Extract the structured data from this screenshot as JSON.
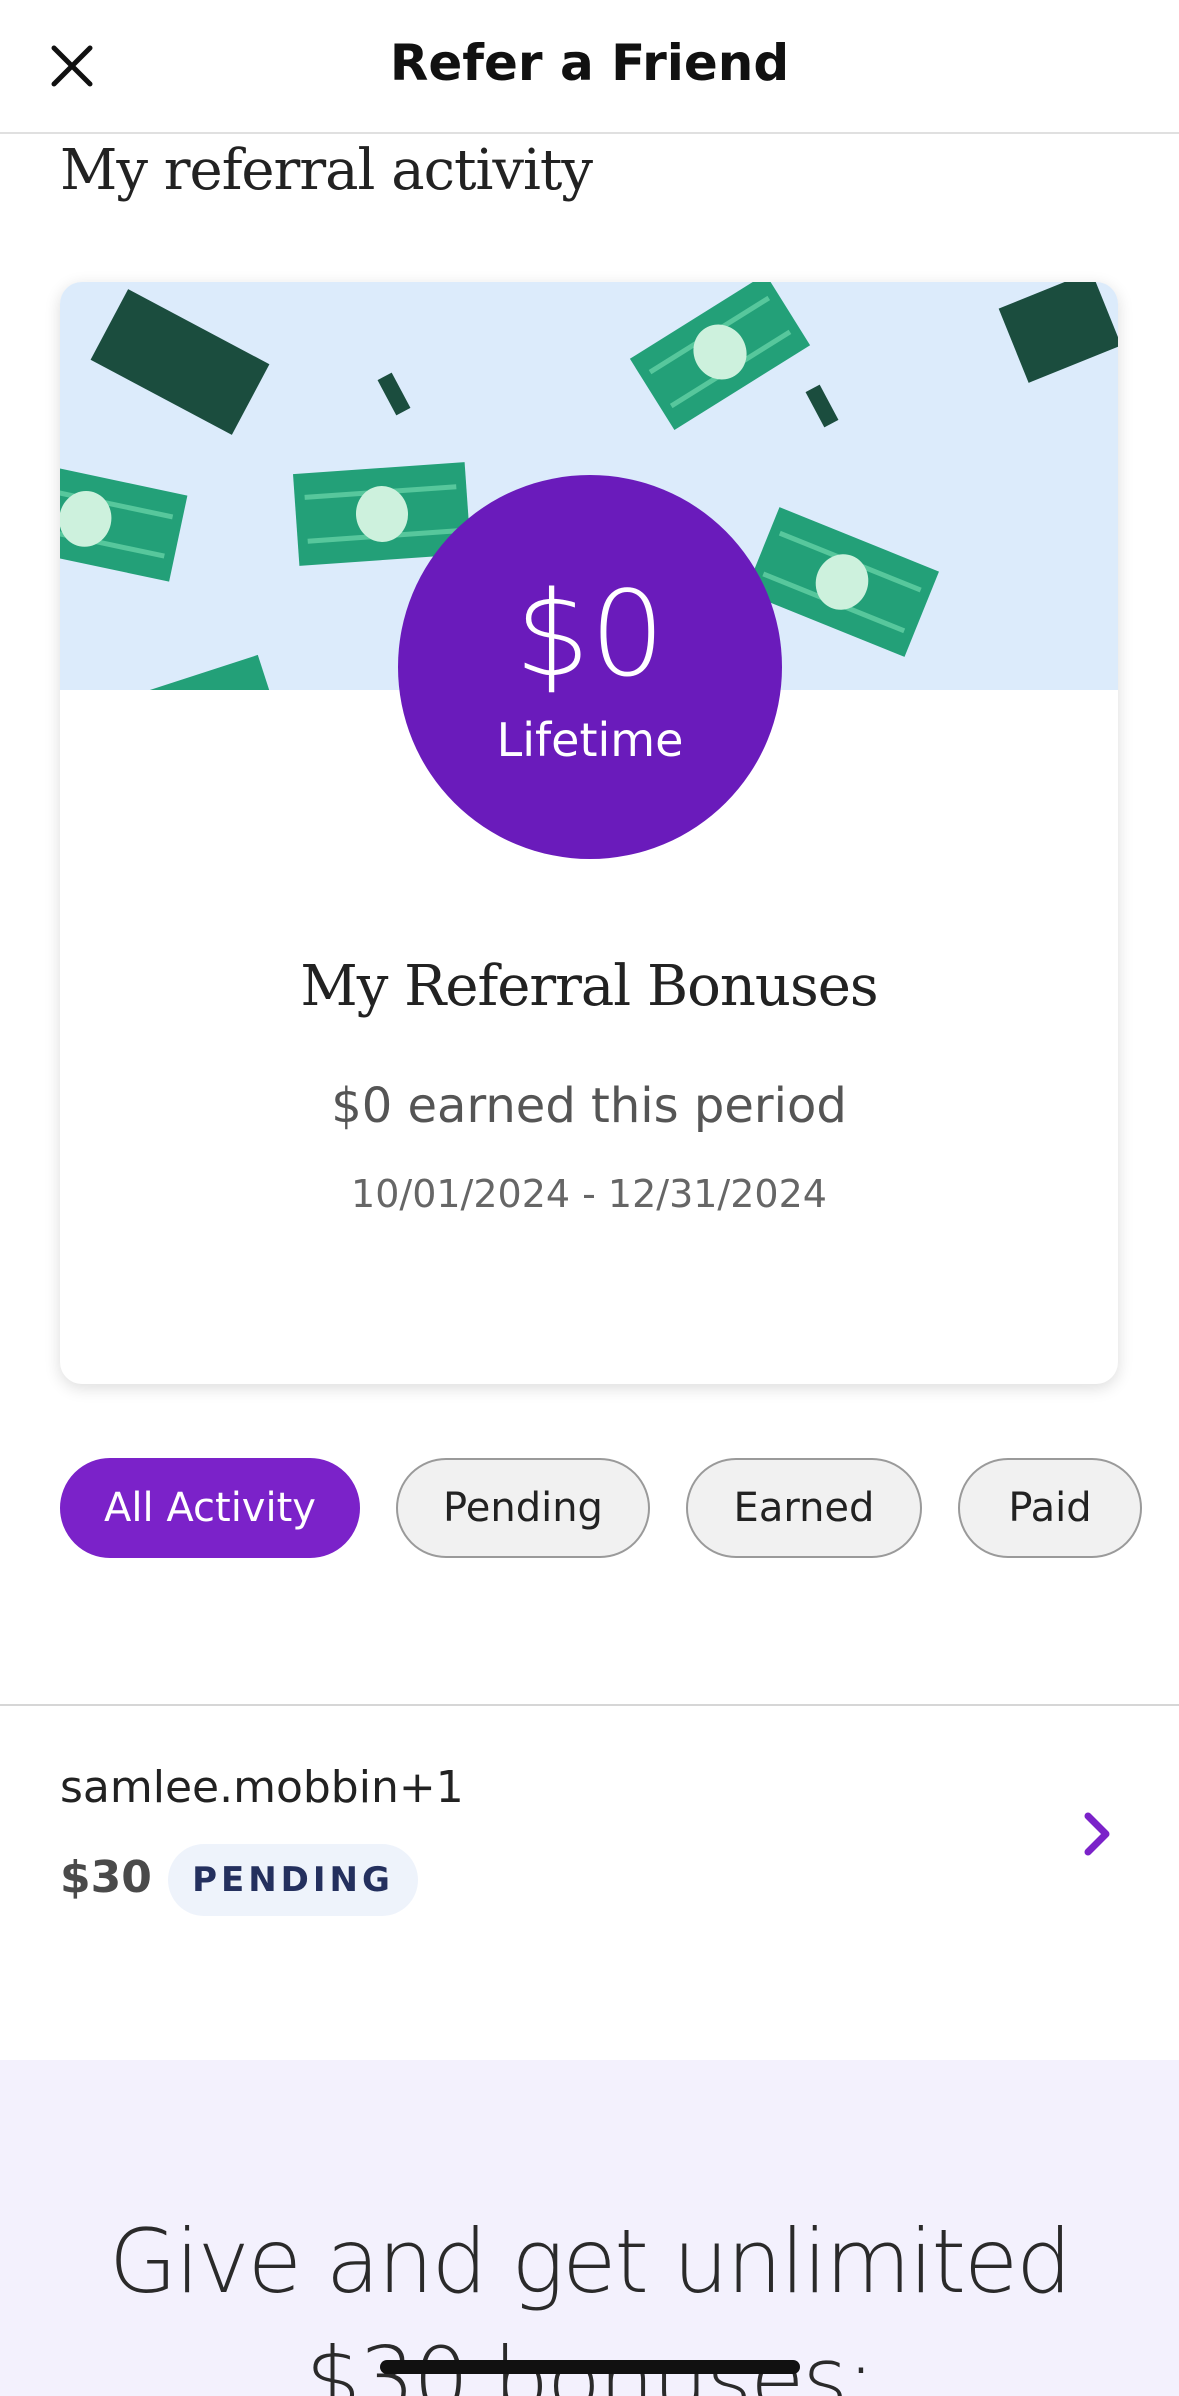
{
  "header": {
    "title": "Refer a Friend",
    "close_icon": "close-icon"
  },
  "activity_section": {
    "title": "My referral activity"
  },
  "summary_card": {
    "lifetime_amount": "$0",
    "lifetime_label": "Lifetime",
    "title": "My Referral Bonuses",
    "period_text": "$0 earned this period",
    "date_range": "10/01/2024 - 12/31/2024",
    "colors": {
      "circle": "#6a1bbb",
      "banner": "#dcebfb",
      "money_dark": "#1b4d3e",
      "money_light": "#23a078"
    }
  },
  "filters": {
    "items": [
      "All Activity",
      "Pending",
      "Earned",
      "Paid"
    ],
    "selected": "All Activity",
    "accent_color": "#7b22c9"
  },
  "activity_list": [
    {
      "name": "samlee.mobbin+1",
      "amount": "$30",
      "status": "PENDING",
      "icon": "chevron-right-icon"
    }
  ],
  "promo": {
    "line1": "Give and get unlimited",
    "line2": "$30 bonuses:"
  }
}
